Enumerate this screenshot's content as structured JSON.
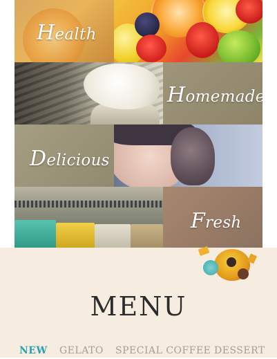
{
  "hero": {
    "tiles": [
      {
        "label_initial": "H",
        "label_rest": "ealth"
      },
      {
        "label_initial": "H",
        "label_rest": "omemade"
      },
      {
        "label_initial": "D",
        "label_rest": "elicious"
      },
      {
        "label_initial": "F",
        "label_rest": "resh"
      }
    ]
  },
  "menu": {
    "title": "MENU",
    "tabs": [
      {
        "label": "NEW",
        "active": true
      },
      {
        "label": "GELATO",
        "active": false
      },
      {
        "label": "SPECIAL COFFEE",
        "active": false
      },
      {
        "label": "DESSERT",
        "active": false
      }
    ]
  },
  "colors": {
    "band_background": "#f6ecdf",
    "active_tab": "#2aa0b4",
    "inactive_tab": "#a79d91",
    "title": "#2c2c2c"
  }
}
